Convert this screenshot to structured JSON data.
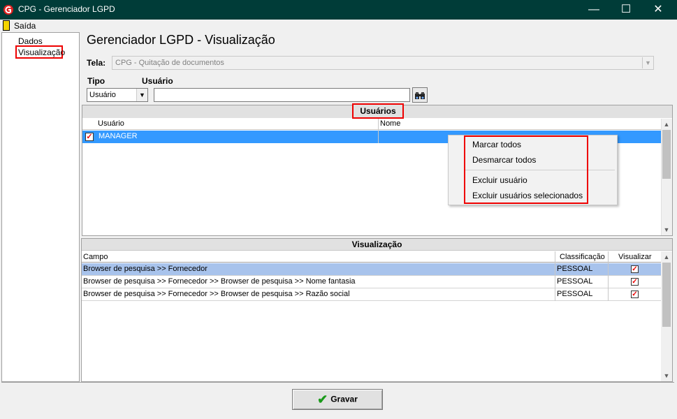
{
  "window": {
    "title": "CPG - Gerenciador LGPD",
    "minimize": "—",
    "maximize": "☐",
    "close": "✕"
  },
  "menu": {
    "exit_label": "Saída"
  },
  "nav": {
    "items": [
      {
        "label": "Dados"
      },
      {
        "label": "Visualização"
      }
    ]
  },
  "page": {
    "title": "Gerenciador LGPD - Visualização"
  },
  "tela": {
    "label": "Tela:",
    "value": "CPG - Quitação de documentos"
  },
  "filter": {
    "tipo_label": "Tipo",
    "usuario_label": "Usuário",
    "tipo_value": "Usuário",
    "usuario_value": ""
  },
  "users": {
    "title": "Usuários",
    "columns": [
      "Usuário",
      "Nome"
    ],
    "rows": [
      {
        "checked": true,
        "usuario": "MANAGER",
        "nome": ""
      }
    ]
  },
  "context_menu": {
    "items": [
      "Marcar todos",
      "Desmarcar todos",
      "Excluir usuário",
      "Excluir usuários selecionados"
    ]
  },
  "visualizacao": {
    "title": "Visualização",
    "columns": [
      "Campo",
      "Classificação",
      "Visualizar"
    ],
    "rows": [
      {
        "campo": "Browser de pesquisa >> Fornecedor",
        "classificacao": "PESSOAL",
        "visualizar": true
      },
      {
        "campo": "Browser de pesquisa >> Fornecedor >> Browser de pesquisa >>  Nome fantasia",
        "classificacao": "PESSOAL",
        "visualizar": true
      },
      {
        "campo": "Browser de pesquisa >> Fornecedor >> Browser de pesquisa >>  Razão social",
        "classificacao": "PESSOAL",
        "visualizar": true
      }
    ]
  },
  "footer": {
    "save_label": "Gravar"
  },
  "colors": {
    "titlebar": "#003c38",
    "selection": "#3399ff",
    "row_highlight": "#a8c3ec",
    "annotation": "#e00000",
    "check_green": "#1a9a1a"
  }
}
